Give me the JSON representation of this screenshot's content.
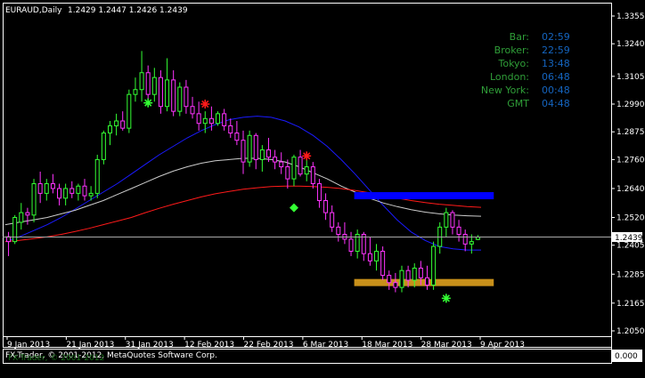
{
  "header": {
    "symbol": "EURAUD,Daily",
    "ohlc": "1.2429 1.2447 1.2426 1.2439"
  },
  "info_panel": {
    "labels": [
      "Bar:",
      "Broker:",
      "Tokyo:",
      "London:",
      "New York:",
      "GMT"
    ],
    "values": [
      "02:59",
      "22:59",
      "13:48",
      "06:48",
      "00:48",
      "04:48"
    ],
    "label_color": "#2f9e38",
    "value_color": "#1565c0"
  },
  "copyright": "FX-Trader, © 2001-2012, MetaQuotes Software Corp.",
  "copyright_overlay": "FX-Trader, © 2001-2012",
  "current_price": "1.2439",
  "indicator_box_value": "0.000",
  "colors": {
    "bull": "#33ff33",
    "bear": "#ff33ff",
    "ma_fast": "#1a1aff",
    "ma_mid": "#cccccc",
    "ma_slow": "#ff1a1a",
    "zone_upper": "#0000ff",
    "zone_lower": "#c8901a"
  },
  "chart_data": {
    "type": "candlestick",
    "x_labels": [
      "9 Jan 2013",
      "21 Jan 2013",
      "31 Jan 2013",
      "12 Feb 2013",
      "22 Feb 2013",
      "6 Mar 2013",
      "18 Mar 2013",
      "28 Mar 2013",
      "9 Apr 2013"
    ],
    "y_ticks": [
      "1.3355",
      "1.3240",
      "1.3105",
      "1.2990",
      "1.2875",
      "1.2760",
      "1.2640",
      "1.2520",
      "1.2405",
      "1.2285",
      "1.2165",
      "1.2050"
    ],
    "ylim": [
      1.205,
      1.3355
    ],
    "current_price": 1.2439,
    "candles": [
      {
        "o": 1.244,
        "h": 1.246,
        "l": 1.236,
        "c": 1.242
      },
      {
        "o": 1.242,
        "h": 1.253,
        "l": 1.241,
        "c": 1.252
      },
      {
        "o": 1.25,
        "h": 1.258,
        "l": 1.247,
        "c": 1.254
      },
      {
        "o": 1.254,
        "h": 1.256,
        "l": 1.249,
        "c": 1.253
      },
      {
        "o": 1.253,
        "h": 1.268,
        "l": 1.25,
        "c": 1.266
      },
      {
        "o": 1.266,
        "h": 1.271,
        "l": 1.258,
        "c": 1.262
      },
      {
        "o": 1.262,
        "h": 1.268,
        "l": 1.259,
        "c": 1.266
      },
      {
        "o": 1.266,
        "h": 1.27,
        "l": 1.262,
        "c": 1.264
      },
      {
        "o": 1.264,
        "h": 1.266,
        "l": 1.257,
        "c": 1.26
      },
      {
        "o": 1.26,
        "h": 1.266,
        "l": 1.257,
        "c": 1.264
      },
      {
        "o": 1.264,
        "h": 1.267,
        "l": 1.26,
        "c": 1.262
      },
      {
        "o": 1.262,
        "h": 1.266,
        "l": 1.259,
        "c": 1.265
      },
      {
        "o": 1.265,
        "h": 1.268,
        "l": 1.259,
        "c": 1.261
      },
      {
        "o": 1.261,
        "h": 1.265,
        "l": 1.259,
        "c": 1.262
      },
      {
        "o": 1.262,
        "h": 1.278,
        "l": 1.26,
        "c": 1.276
      },
      {
        "o": 1.276,
        "h": 1.288,
        "l": 1.274,
        "c": 1.287
      },
      {
        "o": 1.287,
        "h": 1.292,
        "l": 1.282,
        "c": 1.29
      },
      {
        "o": 1.29,
        "h": 1.295,
        "l": 1.286,
        "c": 1.292
      },
      {
        "o": 1.292,
        "h": 1.296,
        "l": 1.288,
        "c": 1.289
      },
      {
        "o": 1.289,
        "h": 1.305,
        "l": 1.287,
        "c": 1.303
      },
      {
        "o": 1.303,
        "h": 1.31,
        "l": 1.3,
        "c": 1.305
      },
      {
        "o": 1.305,
        "h": 1.321,
        "l": 1.3,
        "c": 1.312
      },
      {
        "o": 1.312,
        "h": 1.315,
        "l": 1.3,
        "c": 1.303
      },
      {
        "o": 1.303,
        "h": 1.314,
        "l": 1.3,
        "c": 1.31
      },
      {
        "o": 1.31,
        "h": 1.313,
        "l": 1.295,
        "c": 1.298
      },
      {
        "o": 1.298,
        "h": 1.318,
        "l": 1.296,
        "c": 1.309
      },
      {
        "o": 1.309,
        "h": 1.313,
        "l": 1.294,
        "c": 1.296
      },
      {
        "o": 1.296,
        "h": 1.308,
        "l": 1.294,
        "c": 1.306
      },
      {
        "o": 1.306,
        "h": 1.309,
        "l": 1.295,
        "c": 1.298
      },
      {
        "o": 1.298,
        "h": 1.302,
        "l": 1.293,
        "c": 1.295
      },
      {
        "o": 1.295,
        "h": 1.3,
        "l": 1.288,
        "c": 1.291
      },
      {
        "o": 1.291,
        "h": 1.296,
        "l": 1.287,
        "c": 1.293
      },
      {
        "o": 1.293,
        "h": 1.298,
        "l": 1.288,
        "c": 1.291
      },
      {
        "o": 1.291,
        "h": 1.296,
        "l": 1.29,
        "c": 1.295
      },
      {
        "o": 1.295,
        "h": 1.297,
        "l": 1.288,
        "c": 1.29
      },
      {
        "o": 1.29,
        "h": 1.293,
        "l": 1.285,
        "c": 1.287
      },
      {
        "o": 1.287,
        "h": 1.292,
        "l": 1.282,
        "c": 1.284
      },
      {
        "o": 1.284,
        "h": 1.288,
        "l": 1.27,
        "c": 1.275
      },
      {
        "o": 1.275,
        "h": 1.288,
        "l": 1.273,
        "c": 1.286
      },
      {
        "o": 1.286,
        "h": 1.287,
        "l": 1.272,
        "c": 1.276
      },
      {
        "o": 1.276,
        "h": 1.282,
        "l": 1.271,
        "c": 1.28
      },
      {
        "o": 1.28,
        "h": 1.285,
        "l": 1.275,
        "c": 1.277
      },
      {
        "o": 1.277,
        "h": 1.28,
        "l": 1.272,
        "c": 1.275
      },
      {
        "o": 1.275,
        "h": 1.279,
        "l": 1.27,
        "c": 1.273
      },
      {
        "o": 1.273,
        "h": 1.276,
        "l": 1.264,
        "c": 1.268
      },
      {
        "o": 1.268,
        "h": 1.278,
        "l": 1.265,
        "c": 1.277
      },
      {
        "o": 1.277,
        "h": 1.28,
        "l": 1.269,
        "c": 1.27
      },
      {
        "o": 1.27,
        "h": 1.276,
        "l": 1.267,
        "c": 1.273
      },
      {
        "o": 1.273,
        "h": 1.275,
        "l": 1.264,
        "c": 1.266
      },
      {
        "o": 1.266,
        "h": 1.268,
        "l": 1.256,
        "c": 1.259
      },
      {
        "o": 1.259,
        "h": 1.262,
        "l": 1.251,
        "c": 1.254
      },
      {
        "o": 1.254,
        "h": 1.257,
        "l": 1.246,
        "c": 1.248
      },
      {
        "o": 1.248,
        "h": 1.25,
        "l": 1.242,
        "c": 1.245
      },
      {
        "o": 1.245,
        "h": 1.25,
        "l": 1.241,
        "c": 1.243
      },
      {
        "o": 1.243,
        "h": 1.246,
        "l": 1.236,
        "c": 1.238
      },
      {
        "o": 1.238,
        "h": 1.247,
        "l": 1.235,
        "c": 1.245
      },
      {
        "o": 1.245,
        "h": 1.246,
        "l": 1.234,
        "c": 1.237
      },
      {
        "o": 1.237,
        "h": 1.244,
        "l": 1.232,
        "c": 1.234
      },
      {
        "o": 1.234,
        "h": 1.241,
        "l": 1.23,
        "c": 1.238
      },
      {
        "o": 1.238,
        "h": 1.24,
        "l": 1.226,
        "c": 1.228
      },
      {
        "o": 1.228,
        "h": 1.23,
        "l": 1.222,
        "c": 1.225
      },
      {
        "o": 1.225,
        "h": 1.229,
        "l": 1.221,
        "c": 1.223
      },
      {
        "o": 1.223,
        "h": 1.232,
        "l": 1.221,
        "c": 1.23
      },
      {
        "o": 1.23,
        "h": 1.232,
        "l": 1.223,
        "c": 1.226
      },
      {
        "o": 1.226,
        "h": 1.233,
        "l": 1.223,
        "c": 1.231
      },
      {
        "o": 1.231,
        "h": 1.234,
        "l": 1.224,
        "c": 1.227
      },
      {
        "o": 1.227,
        "h": 1.232,
        "l": 1.222,
        "c": 1.224
      },
      {
        "o": 1.224,
        "h": 1.242,
        "l": 1.222,
        "c": 1.24
      },
      {
        "o": 1.24,
        "h": 1.25,
        "l": 1.237,
        "c": 1.248
      },
      {
        "o": 1.248,
        "h": 1.256,
        "l": 1.244,
        "c": 1.254
      },
      {
        "o": 1.254,
        "h": 1.255,
        "l": 1.245,
        "c": 1.248
      },
      {
        "o": 1.248,
        "h": 1.251,
        "l": 1.242,
        "c": 1.245
      },
      {
        "o": 1.245,
        "h": 1.247,
        "l": 1.238,
        "c": 1.241
      },
      {
        "o": 1.241,
        "h": 1.245,
        "l": 1.237,
        "c": 1.242
      },
      {
        "o": 1.2429,
        "h": 1.2447,
        "l": 1.2426,
        "c": 1.2439
      }
    ],
    "ma_fast": [
      1.242,
      1.244,
      1.2465,
      1.249,
      1.252,
      1.2555,
      1.259,
      1.2625,
      1.266,
      1.27,
      1.274,
      1.278,
      1.2815,
      1.285,
      1.288,
      1.2905,
      1.2925,
      1.2935,
      1.294,
      1.2935,
      1.292,
      1.2895,
      1.286,
      1.2815,
      1.276,
      1.27,
      1.2635,
      1.257,
      1.251,
      1.246,
      1.2425,
      1.24,
      1.239,
      1.2385,
      1.2385
    ],
    "ma_mid": [
      1.249,
      1.25,
      1.251,
      1.252,
      1.2535,
      1.255,
      1.257,
      1.259,
      1.2615,
      1.264,
      1.2665,
      1.269,
      1.2712,
      1.273,
      1.2745,
      1.2755,
      1.276,
      1.2765,
      1.2765,
      1.276,
      1.275,
      1.273,
      1.2705,
      1.268,
      1.265,
      1.2625,
      1.26,
      1.258,
      1.2565,
      1.2552,
      1.2542,
      1.2535,
      1.253,
      1.2527,
      1.2525
    ],
    "ma_slow": [
      1.242,
      1.2425,
      1.2432,
      1.244,
      1.245,
      1.2462,
      1.2475,
      1.249,
      1.2505,
      1.252,
      1.254,
      1.2558,
      1.2575,
      1.259,
      1.2605,
      1.2618,
      1.2628,
      1.2637,
      1.2643,
      1.2648,
      1.265,
      1.265,
      1.2648,
      1.2645,
      1.264,
      1.2632,
      1.2622,
      1.2612,
      1.26,
      1.259,
      1.2582,
      1.2575,
      1.257,
      1.2565,
      1.2562
    ],
    "zones": [
      {
        "top": 1.2625,
        "bottom": 1.26,
        "from_bar": 55,
        "to_bar": 77,
        "name": "upper"
      },
      {
        "top": 1.2265,
        "bottom": 1.224,
        "from_bar": 55,
        "to_bar": 77,
        "name": "lower"
      }
    ],
    "markers": [
      {
        "kind": "star",
        "bar": 22,
        "price": 1.2995,
        "color": "#33ff33"
      },
      {
        "kind": "star",
        "bar": 31,
        "price": 1.299,
        "color": "#ff1a1a"
      },
      {
        "kind": "star",
        "bar": 47,
        "price": 1.2775,
        "color": "#ff1a1a"
      },
      {
        "kind": "diamond",
        "bar": 45,
        "price": 1.256,
        "color": "#33ff33"
      },
      {
        "kind": "star",
        "bar": 69,
        "price": 1.2185,
        "color": "#33ff33"
      }
    ]
  }
}
